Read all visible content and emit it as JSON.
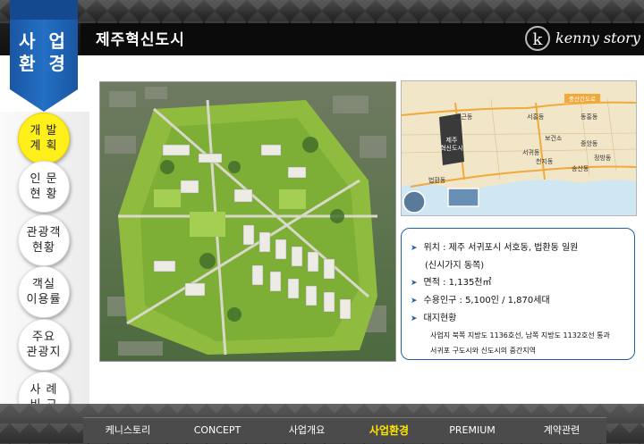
{
  "header": {
    "page_title": "제주혁신도시",
    "logo_mark": "k",
    "logo_text": "kenny story"
  },
  "section": {
    "label": "사 업\n환 경",
    "color": "#1e5fae"
  },
  "side_menu": [
    {
      "label": "개 발\n계 획",
      "active": true
    },
    {
      "label": "인 문\n현 황",
      "active": false
    },
    {
      "label": "관광객\n현황",
      "active": false
    },
    {
      "label": "객실\n이용률",
      "active": false
    },
    {
      "label": "주요\n관광지",
      "active": false
    },
    {
      "label": "사 례\n비 교",
      "active": false
    }
  ],
  "map": {
    "top_road_label": "중산간도로",
    "project_label": "제주\n혁신도시",
    "districts": [
      "호근동",
      "서홍동",
      "동홍동",
      "법환동",
      "서귀동",
      "천지동",
      "중앙동",
      "정방동",
      "송산동",
      "보건소"
    ]
  },
  "info": {
    "location": "위치 : 제주 서귀포시 서호동, 법환동 일원",
    "location_sub": "(신시가지 동쪽)",
    "area": "면적 : 1,135천㎡",
    "population": "수용인구 : 5,100인 / 1,870세대",
    "site_status_heading": "대지현황",
    "site_status_line1": "사업지 북쪽 지방도 1136호선, 남쪽 지방도 1132호선 통과",
    "site_status_line2": "서귀포 구도시와 신도시의 중간지역"
  },
  "bottom_nav": [
    {
      "label": "케니스토리",
      "active": false
    },
    {
      "label": "CONCEPT",
      "active": false
    },
    {
      "label": "사업개요",
      "active": false
    },
    {
      "label": "사업환경",
      "active": true
    },
    {
      "label": "PREMIUM",
      "active": false
    },
    {
      "label": "계약관련",
      "active": false
    }
  ],
  "colors": {
    "active_menu": "#ffef1a",
    "active_nav_text": "#ffe500",
    "accent_blue": "#1e5fae"
  }
}
